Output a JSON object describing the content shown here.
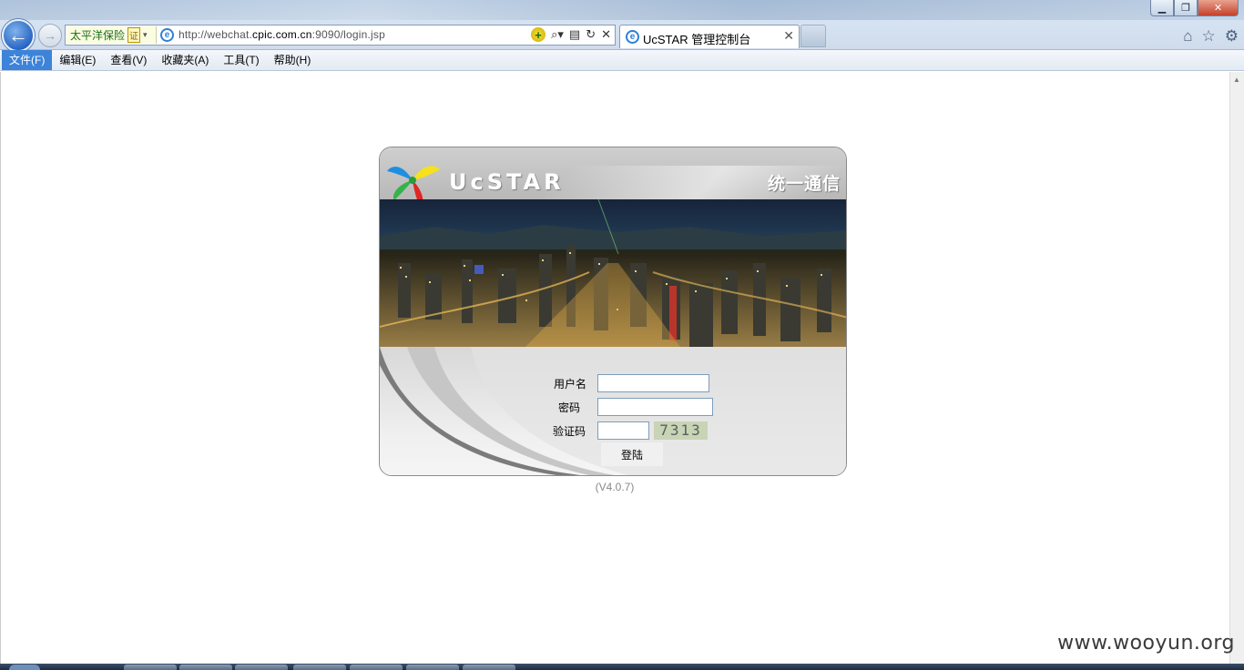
{
  "browser": {
    "cert_label": "太平洋保险",
    "cert_badge": "证",
    "url_prefix": "http://webchat.",
    "url_domain": "cpic.com.cn",
    "url_suffix": ":9090/login.jsp",
    "tab_title": "UcSTAR 管理控制台"
  },
  "menu": {
    "items": [
      "文件(F)",
      "编辑(E)",
      "查看(V)",
      "收藏夹(A)",
      "工具(T)",
      "帮助(H)"
    ]
  },
  "login": {
    "brand": "UcSTAR",
    "slogan": "统一通信",
    "username_label": "用户名",
    "password_label": "密码",
    "captcha_label": "验证码",
    "captcha_value": "7313",
    "submit_label": "登陆",
    "version": "(V4.0.7)"
  },
  "watermark": "www.wooyun.org"
}
